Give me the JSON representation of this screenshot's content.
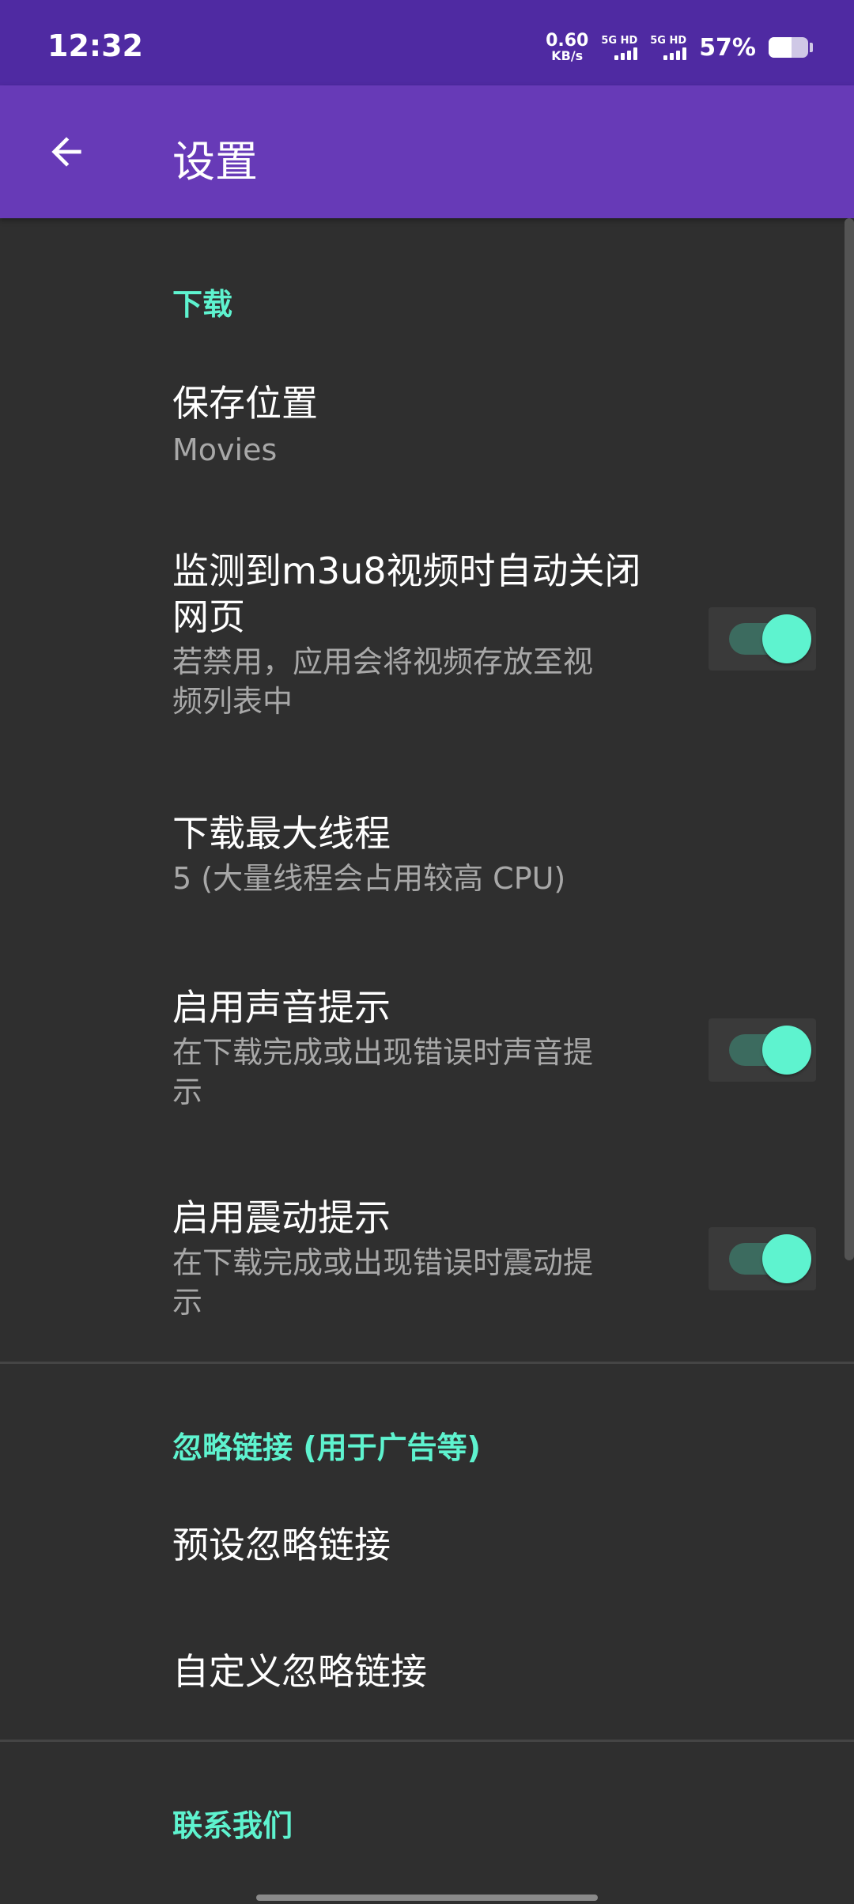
{
  "status_bar": {
    "time": "12:32",
    "net_speed_value": "0.60",
    "net_speed_unit": "KB/s",
    "sim1_label": "5G HD",
    "sim2_label": "5G HD",
    "battery_pct": "57%",
    "battery_level": 0.57
  },
  "app_bar": {
    "back_icon": "arrow-left-icon",
    "title": "设置"
  },
  "sections": {
    "download": {
      "header": "下载",
      "save_location": {
        "title": "保存位置",
        "summary": "Movies"
      },
      "auto_close": {
        "title_line1": "监测到m3u8视频时自动关闭",
        "title_line2": "网页",
        "summary_line1": "若禁用，应用会将视频存放至视",
        "summary_line2": "频列表中",
        "enabled": true
      },
      "max_threads": {
        "title": "下载最大线程",
        "summary": "5 (大量线程会占用较高 CPU)"
      },
      "sound_alert": {
        "title": "启用声音提示",
        "summary_line1": "在下载完成或出现错误时声音提",
        "summary_line2": "示",
        "enabled": true
      },
      "vibrate_alert": {
        "title": "启用震动提示",
        "summary_line1": "在下载完成或出现错误时震动提",
        "summary_line2": "示",
        "enabled": true
      }
    },
    "ignore": {
      "header": "忽略链接 (用于广告等)",
      "preset": {
        "title": "预设忽略链接"
      },
      "custom": {
        "title": "自定义忽略链接"
      }
    },
    "contact": {
      "header": "联系我们"
    }
  },
  "colors": {
    "status_bar": "#4f2aa2",
    "app_bar": "#673ab7",
    "background": "#2f2f2f",
    "accent": "#5ef3cf"
  }
}
